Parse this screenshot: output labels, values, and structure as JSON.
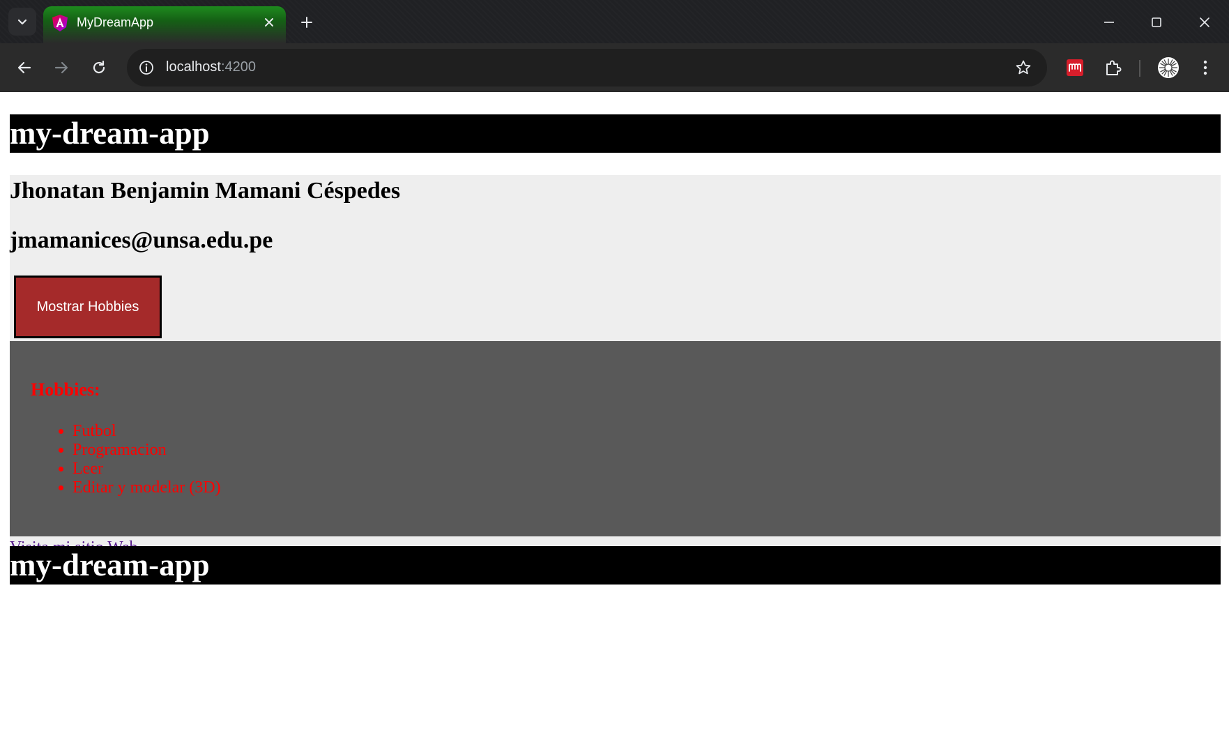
{
  "browser": {
    "tab_title": "MyDreamApp",
    "url_host": "localhost",
    "url_port": ":4200"
  },
  "page": {
    "header_title": "my-dream-app",
    "name": "Jhonatan Benjamin Mamani Céspedes",
    "email": "jmamanices@unsa.edu.pe",
    "button_label": "Mostrar Hobbies",
    "hobbies_title": "Hobbies:",
    "hobbies": [
      "Futbol",
      "Programacion",
      "Leer",
      "Editar y modelar (3D)"
    ],
    "link_label": "Visita mi sitio Web",
    "input_value": "",
    "footer_title": "my-dream-app"
  },
  "colors": {
    "header_bg": "#000000",
    "button_bg": "#a52a2a",
    "hobbies_bg": "#595959",
    "hobbies_text": "#ff0000",
    "profile_bg": "#eeeeee",
    "link": "#551a8b"
  },
  "icons": {
    "tab_search": "chevron-down-icon",
    "tab_favicon": "angular-icon",
    "tab_close": "close-icon",
    "new_tab": "plus-icon",
    "back": "arrow-left-icon",
    "forward": "arrow-right-icon",
    "reload": "reload-icon",
    "site_info": "info-icon",
    "bookmark": "star-icon",
    "extension_1": "mendeley-icon",
    "extensions": "puzzle-icon",
    "profile": "avatar-icon",
    "menu": "kebab-menu-icon"
  }
}
